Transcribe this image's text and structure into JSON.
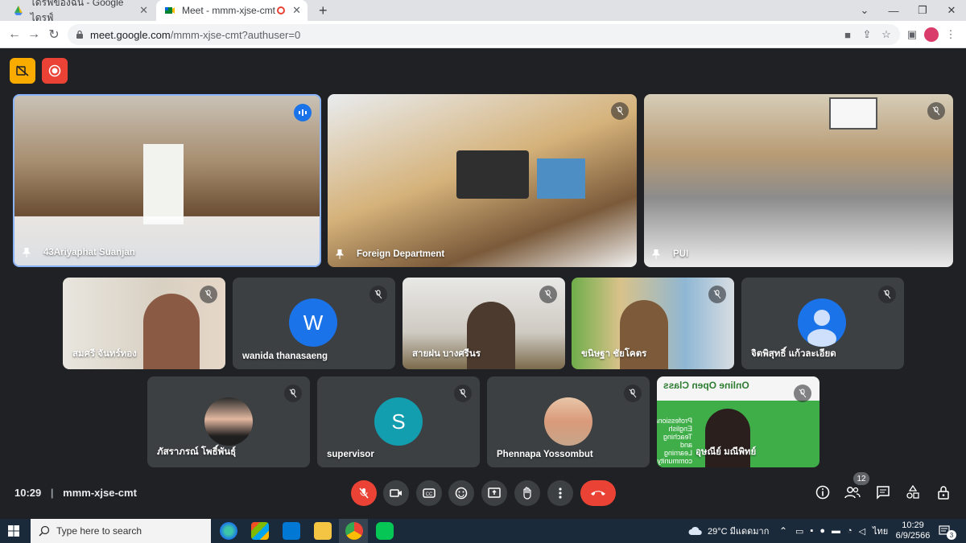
{
  "browser": {
    "tabs": [
      {
        "title": "ไดรฟ์ของฉัน - Google ไดรฟ์",
        "icon": "google-drive-icon"
      },
      {
        "title": "Meet - mmm-xjse-cmt",
        "icon": "google-meet-icon"
      }
    ],
    "url_host": "meet.google.com",
    "url_path": "/mmm-xjse-cmt?authuser=0"
  },
  "meet": {
    "time": "10:29",
    "meeting_code": "mmm-xjse-cmt",
    "participant_count": "12",
    "accent": "#8ab4f8",
    "red": "#ea4335"
  },
  "tiles": {
    "t1": "43Ariyaphat Suanjan",
    "t2": "Foreign Department",
    "t3": "PUI",
    "t4": "สมศรี จันทร์ทอง",
    "t5": "wanida thanasaeng",
    "t6": "สายฝน บางศรีนร",
    "t7": "ขนิษฐา ชัยโคตร",
    "t8": "จิตพิสุทธิ์ แก้วละเอียด",
    "t9": "ภัสราภรณ์ โพธิ์พันธุ์",
    "t10": "supervisor",
    "t11": "Phennapa Yossombut",
    "t12": "อุษณีย์ มณีพิทย์",
    "avatar_w": "W",
    "avatar_s": "S",
    "slide_title": "Online Open Class",
    "slide_lines": [
      "Professional",
      "English",
      "Teaching",
      "and",
      "Learning",
      "community"
    ]
  },
  "taskbar": {
    "search_placeholder": "Type here to search",
    "weather": "29°C  มีแดดมาก",
    "lang": "ไทย",
    "time": "10:29",
    "date": "6/9/2566",
    "notif": "3"
  }
}
